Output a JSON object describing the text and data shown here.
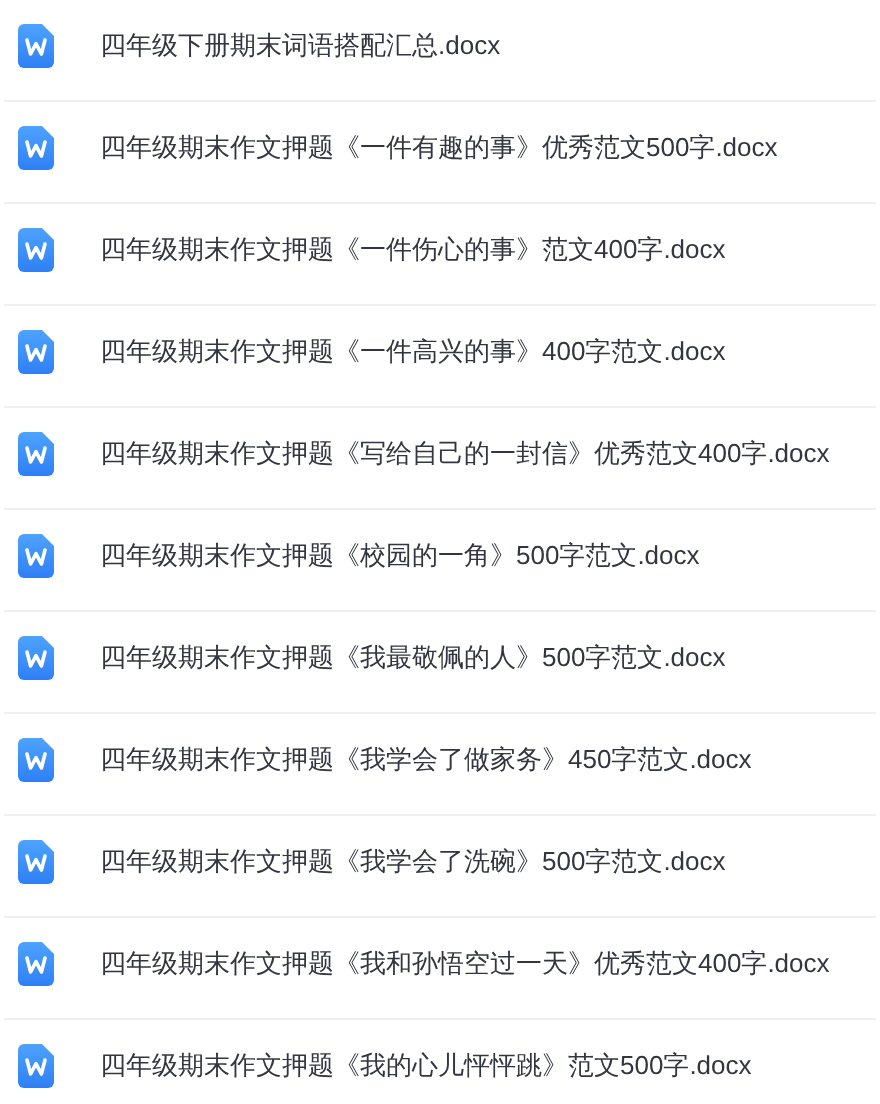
{
  "files": [
    {
      "name": "四年级下册期末词语搭配汇总.docx"
    },
    {
      "name": "四年级期末作文押题《一件有趣的事》优秀范文500字.docx"
    },
    {
      "name": "四年级期末作文押题《一件伤心的事》范文400字.docx"
    },
    {
      "name": "四年级期末作文押题《一件高兴的事》400字范文.docx"
    },
    {
      "name": "四年级期末作文押题《写给自己的一封信》优秀范文400字.docx"
    },
    {
      "name": "四年级期末作文押题《校园的一角》500字范文.docx"
    },
    {
      "name": "四年级期末作文押题《我最敬佩的人》500字范文.docx"
    },
    {
      "name": "四年级期末作文押题《我学会了做家务》450字范文.docx"
    },
    {
      "name": "四年级期末作文押题《我学会了洗碗》500字范文.docx"
    },
    {
      "name": "四年级期末作文押题《我和孙悟空过一天》优秀范文400字.docx"
    },
    {
      "name": "四年级期末作文押题《我的心儿怦怦跳》范文500字.docx"
    }
  ]
}
